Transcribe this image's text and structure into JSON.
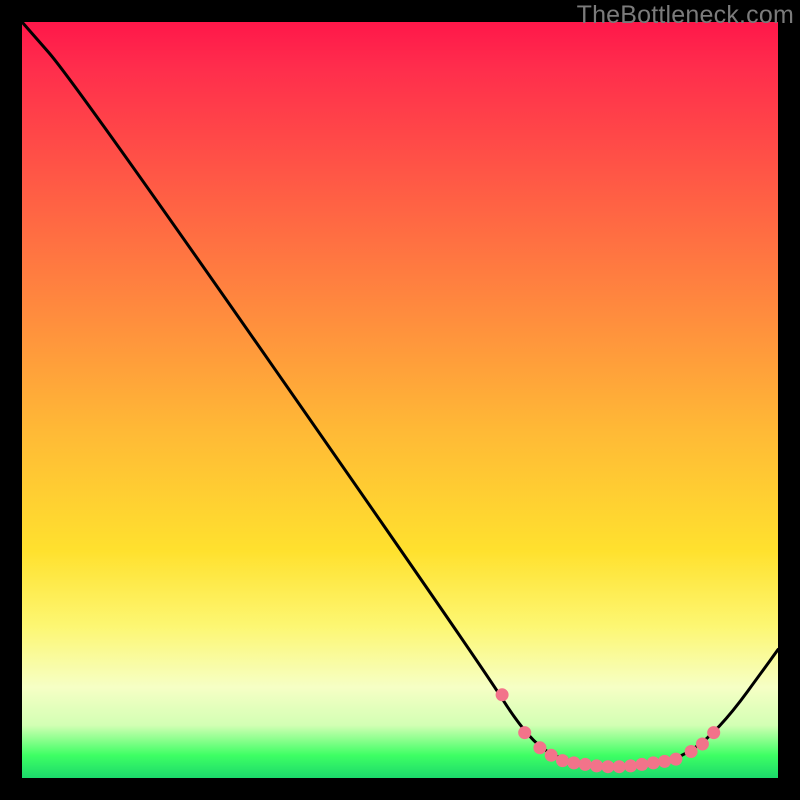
{
  "watermark": "TheBottleneck.com",
  "chart_data": {
    "type": "line",
    "title": "",
    "xlabel": "",
    "ylabel": "",
    "xlim": [
      0,
      100
    ],
    "ylim": [
      0,
      100
    ],
    "curve": [
      {
        "x": 0,
        "y": 100
      },
      {
        "x": 7,
        "y": 92
      },
      {
        "x": 60,
        "y": 16
      },
      {
        "x": 67,
        "y": 5
      },
      {
        "x": 72,
        "y": 2
      },
      {
        "x": 80,
        "y": 1.5
      },
      {
        "x": 86,
        "y": 2
      },
      {
        "x": 92,
        "y": 6
      },
      {
        "x": 100,
        "y": 17
      }
    ],
    "markers": [
      {
        "x": 63.5,
        "y": 11
      },
      {
        "x": 66.5,
        "y": 6
      },
      {
        "x": 68.5,
        "y": 4
      },
      {
        "x": 70.0,
        "y": 3
      },
      {
        "x": 71.5,
        "y": 2.3
      },
      {
        "x": 73.0,
        "y": 2.0
      },
      {
        "x": 74.5,
        "y": 1.8
      },
      {
        "x": 76.0,
        "y": 1.6
      },
      {
        "x": 77.5,
        "y": 1.5
      },
      {
        "x": 79.0,
        "y": 1.5
      },
      {
        "x": 80.5,
        "y": 1.6
      },
      {
        "x": 82.0,
        "y": 1.8
      },
      {
        "x": 83.5,
        "y": 2.0
      },
      {
        "x": 85.0,
        "y": 2.2
      },
      {
        "x": 86.5,
        "y": 2.5
      },
      {
        "x": 88.5,
        "y": 3.5
      },
      {
        "x": 90.0,
        "y": 4.5
      },
      {
        "x": 91.5,
        "y": 6
      }
    ],
    "marker_color": "#f2738a",
    "curve_color": "#000000"
  }
}
